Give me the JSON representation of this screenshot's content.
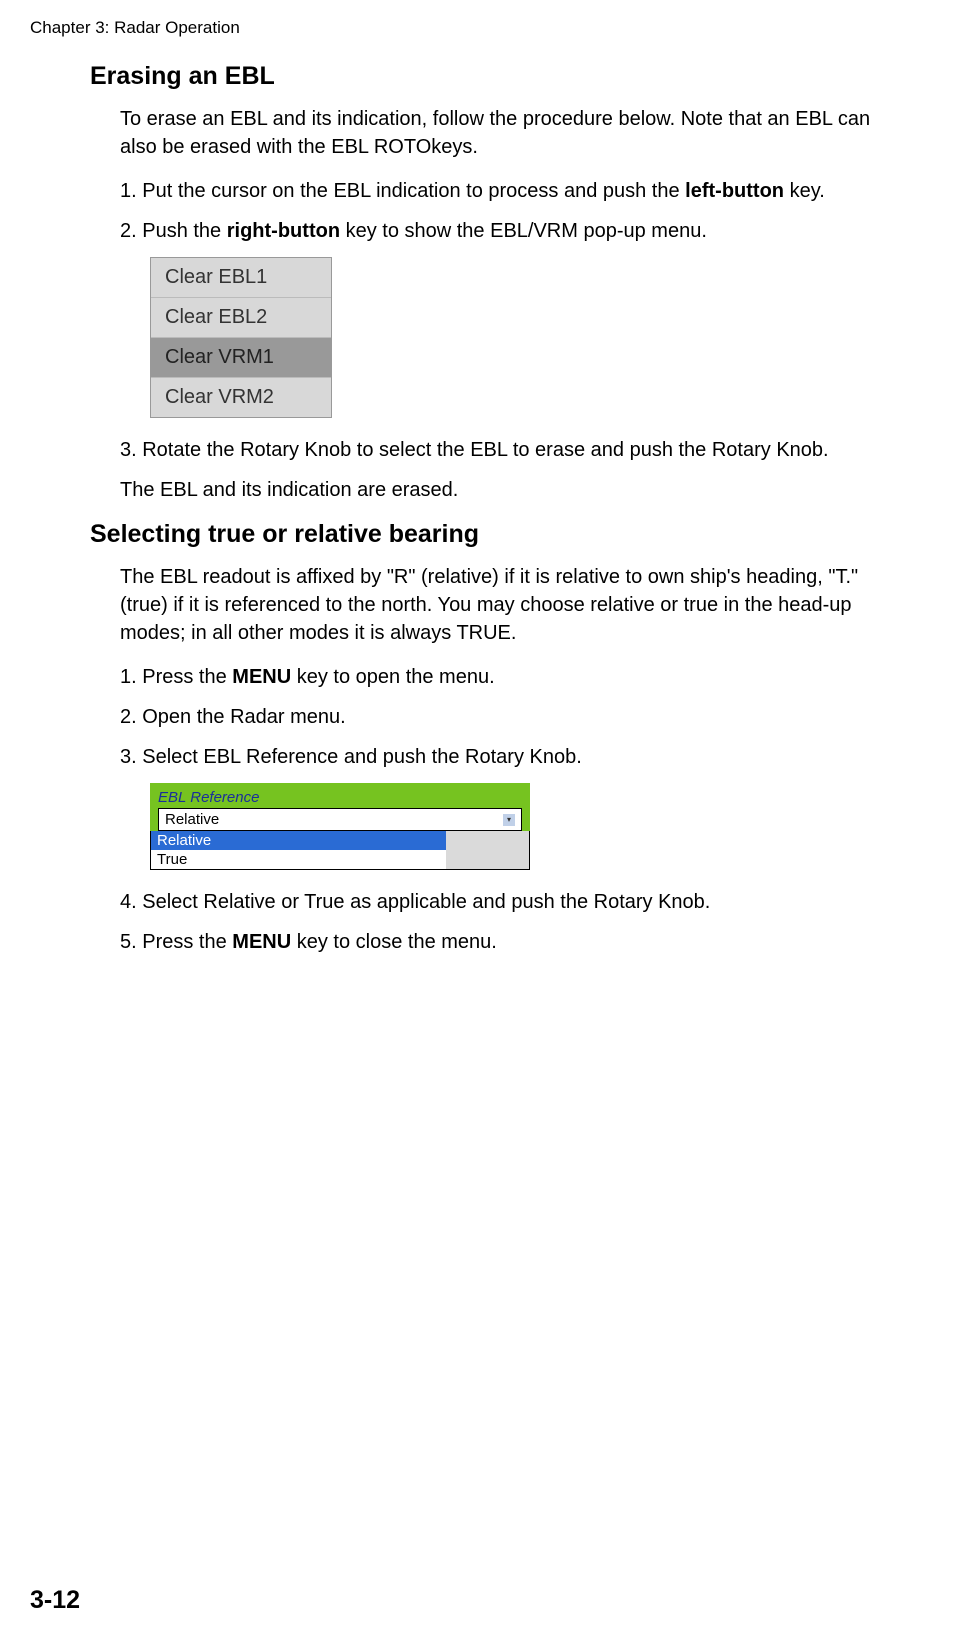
{
  "chapter": "Chapter 3: Radar Operation",
  "section1": {
    "title": "Erasing an EBL",
    "intro": "To erase an EBL and its indication, follow the procedure below. Note that an EBL can also be erased with the EBL ROTOkeys.",
    "step1_pre": "1.  Put the cursor on the EBL indication to process and push the ",
    "step1_bold": "left-button",
    "step1_post": " key.",
    "step2_pre": "2.  Push the ",
    "step2_bold": "right-button",
    "step2_post": " key to show the EBL/VRM pop-up menu.",
    "popup": [
      "Clear EBL1",
      "Clear EBL2",
      "Clear VRM1",
      "Clear VRM2"
    ],
    "step3": "3.  Rotate the Rotary Knob to select the EBL to erase and push the Rotary Knob.",
    "conclusion": "The EBL and its indication are erased."
  },
  "section2": {
    "title": "Selecting true or relative bearing",
    "intro": "The EBL readout is affixed by \"R\" (relative) if it is relative to own ship's heading, \"T.\" (true) if it is referenced to the north. You may choose relative or true in the head-up modes; in all other modes it is always TRUE.",
    "step1_pre": "1.  Press the ",
    "step1_bold": "MENU",
    "step1_post": " key to open the menu.",
    "step2": "2.  Open the Radar menu.",
    "step3": "3.  Select EBL Reference and push the Rotary Knob.",
    "ebl_ref_label": "EBL Reference",
    "ebl_ref_value": "Relative",
    "ebl_ref_options": [
      "Relative",
      "True"
    ],
    "step4": "4.  Select Relative or True as applicable and push the Rotary Knob.",
    "step5_pre": "5.  Press the ",
    "step5_bold": "MENU",
    "step5_post": " key to close the menu."
  },
  "pageNumber": "3-12"
}
